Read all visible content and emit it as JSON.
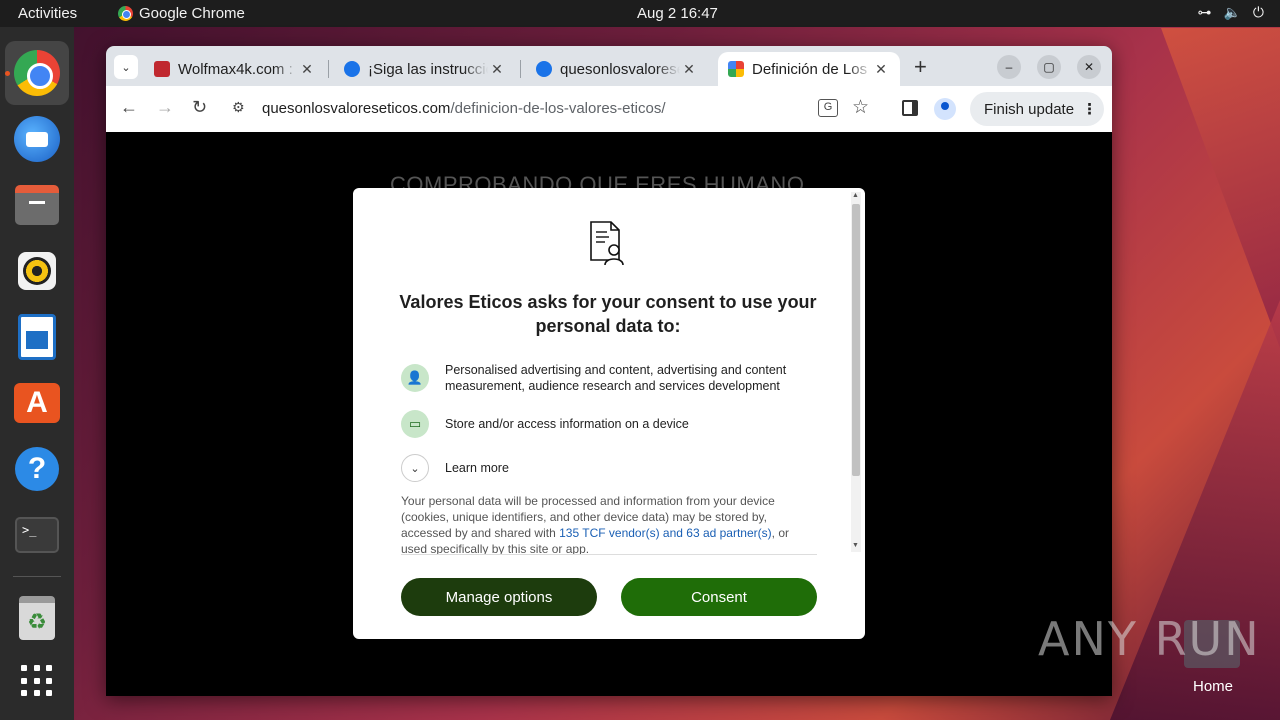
{
  "topbar": {
    "activities": "Activities",
    "app_name": "Google Chrome",
    "clock": "Aug 2  16:47",
    "tray": [
      "network-icon",
      "volume-icon",
      "power-icon"
    ]
  },
  "dock": {
    "apps": [
      "chrome-icon",
      "thunderbird-icon",
      "files-icon",
      "rhythmbox-icon",
      "writer-icon",
      "app-center-icon",
      "help-icon",
      "terminal-icon",
      "trash-icon",
      "show-apps-icon"
    ],
    "terminal_prompt": ">_"
  },
  "browser": {
    "tabs": [
      {
        "title": "Wolfmax4k.com :",
        "favicon_color": "#c0282f"
      },
      {
        "title": "¡Siga las instrucciones",
        "favicon_color": "#1a73e8"
      },
      {
        "title": "quesonlosvaloreseticos",
        "favicon_color": "#1a73e8"
      },
      {
        "title": "Definición de Los Valores",
        "favicon_color": "#e94235",
        "active": true
      }
    ],
    "close_glyph": "✕",
    "new_tab": "+",
    "url_domain": "quesonlosvaloreseticos.com",
    "url_path": "/definicion-de-los-valores-eticos/",
    "finish_update": "Finish update",
    "menu_dots": "⋮"
  },
  "page": {
    "background_heading": "COMPROBANDO QUE ERES HUMANO"
  },
  "consent": {
    "title": "Valores Eticos asks for your consent to use your personal data to:",
    "purposes": [
      {
        "icon": "person-icon",
        "text": "Personalised advertising and content, advertising and content measurement, audience research and services development"
      },
      {
        "icon": "devices-icon",
        "text": "Store and/or access information on a device"
      }
    ],
    "learn_more": "Learn more",
    "disclaimer_before": "Your personal data will be processed and information from your device (cookies, unique identifiers, and other device data) may be stored by, accessed by and shared with ",
    "disclaimer_link": "135 TCF vendor(s) and 63 ad partner(s)",
    "disclaimer_after": ", or used specifically by this site or app.",
    "manage_button": "Manage options",
    "consent_button": "Consent"
  },
  "watermark": {
    "brand": "ANY RUN",
    "home_label": "Home"
  },
  "colors": {
    "consent_green": "#1f6d08",
    "manage_green": "#1d3c0d",
    "link_blue": "#1a5fb4",
    "ubuntu_orange": "#e95420"
  }
}
